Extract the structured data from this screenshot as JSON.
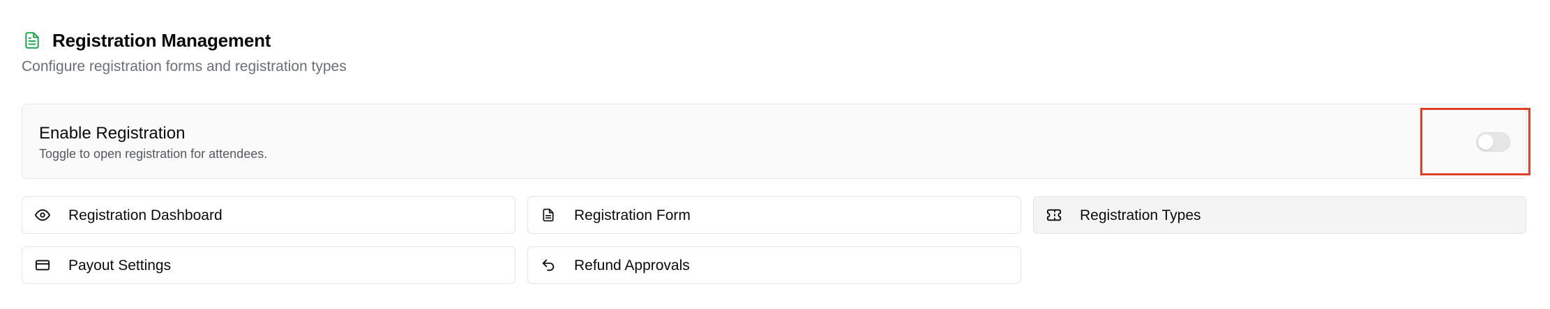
{
  "header": {
    "title": "Registration Management",
    "subtitle": "Configure registration forms and registration types",
    "icon": "file-text-icon",
    "icon_color": "#16a34a"
  },
  "enable_registration": {
    "title": "Enable Registration",
    "description": "Toggle to open registration for attendees.",
    "enabled": false
  },
  "actions": [
    {
      "label": "Registration Dashboard",
      "icon": "eye-icon"
    },
    {
      "label": "Registration Form",
      "icon": "file-text-icon"
    },
    {
      "label": "Registration Types",
      "icon": "ticket-icon",
      "active": true
    },
    {
      "label": "Payout Settings",
      "icon": "credit-card-icon"
    },
    {
      "label": "Refund Approvals",
      "icon": "undo-icon"
    }
  ],
  "colors": {
    "highlight": "#e0402a",
    "toggle_off": "#e6e6e6"
  }
}
